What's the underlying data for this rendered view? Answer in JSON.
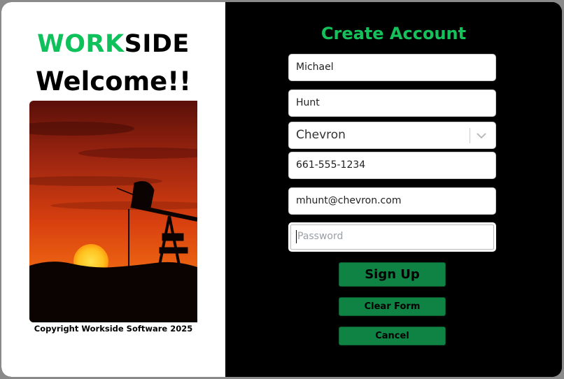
{
  "brand": {
    "part1": "WORK",
    "part2": "SIDE",
    "accent_color": "#0fc15a"
  },
  "welcome": "Welcome!!",
  "copyright": "Copyright Workside Software 2025",
  "form": {
    "title": "Create Account",
    "first_name": "Michael",
    "last_name": "Hunt",
    "company": "Chevron",
    "phone": "661-555-1234",
    "email": "mhunt@chevron.com",
    "password_placeholder": "Password"
  },
  "buttons": {
    "sign_up": "Sign Up",
    "clear_form": "Clear Form",
    "cancel": "Cancel",
    "color": "#0e8343"
  },
  "icons": {
    "company_dropdown": "chevron-down-icon"
  }
}
